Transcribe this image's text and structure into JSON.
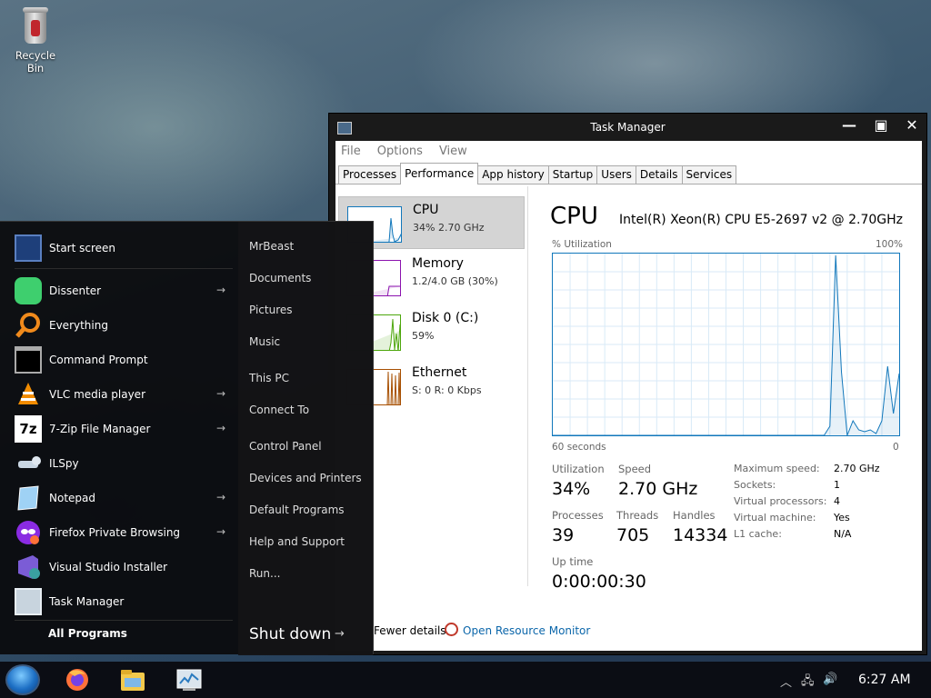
{
  "desktop": {
    "recycle_bin": "Recycle Bin"
  },
  "task_manager": {
    "title": "Task Manager",
    "window_buttons": {
      "minimize": "—",
      "maximize": "▣",
      "close": "✕"
    },
    "menu": [
      "File",
      "Options",
      "View"
    ],
    "tabs": [
      "Processes",
      "Performance",
      "App history",
      "Startup",
      "Users",
      "Details",
      "Services"
    ],
    "active_tab": "Performance",
    "sidebar": [
      {
        "name": "CPU",
        "value": "34% 2.70 GHz",
        "color": "#1177bb"
      },
      {
        "name": "Memory",
        "value": "1.2/4.0 GB (30%)",
        "color": "#8b12ae"
      },
      {
        "name": "Disk 0 (C:)",
        "value": "59%",
        "color": "#4da60c"
      },
      {
        "name": "Ethernet",
        "value": "S: 0 R: 0 Kbps",
        "color": "#a74f01"
      }
    ],
    "cpu": {
      "heading": "CPU",
      "model": "Intel(R) Xeon(R) CPU E5-2697 v2 @ 2.70GHz",
      "graph_label_left": "% Utilization",
      "graph_label_right": "100%",
      "graph_time_left": "60 seconds",
      "graph_time_right": "0",
      "utilization_history_pct": [
        0,
        0,
        0,
        0,
        0,
        0,
        0,
        0,
        0,
        0,
        0,
        0,
        0,
        0,
        0,
        0,
        0,
        0,
        0,
        0,
        0,
        0,
        0,
        0,
        0,
        0,
        0,
        0,
        0,
        0,
        0,
        0,
        0,
        0,
        0,
        0,
        0,
        0,
        0,
        0,
        0,
        0,
        0,
        0,
        0,
        0,
        0,
        0,
        5,
        99,
        35,
        0,
        8,
        3,
        2,
        3,
        1,
        8,
        38,
        12,
        34
      ],
      "stats": {
        "utilization_label": "Utilization",
        "utilization": "34%",
        "speed_label": "Speed",
        "speed": "2.70 GHz",
        "processes_label": "Processes",
        "processes": "39",
        "threads_label": "Threads",
        "threads": "705",
        "handles_label": "Handles",
        "handles": "14334",
        "uptime_label": "Up time",
        "uptime": "0:00:00:30"
      },
      "details": [
        {
          "key": "Maximum speed:",
          "value": "2.70 GHz"
        },
        {
          "key": "Sockets:",
          "value": "1"
        },
        {
          "key": "Virtual processors:",
          "value": "4"
        },
        {
          "key": "Virtual machine:",
          "value": "Yes"
        },
        {
          "key": "L1 cache:",
          "value": "N/A"
        }
      ]
    },
    "footer": {
      "fewer_details": "Fewer details",
      "open_resource_monitor": "Open Resource Monitor"
    }
  },
  "start_menu": {
    "items": [
      {
        "label": "Start screen",
        "arrow": false
      },
      {
        "label": "Dissenter",
        "arrow": true
      },
      {
        "label": "Everything",
        "arrow": false
      },
      {
        "label": "Command Prompt",
        "arrow": false
      },
      {
        "label": "VLC media player",
        "arrow": true
      },
      {
        "label": "7-Zip File Manager",
        "arrow": true
      },
      {
        "label": "ILSpy",
        "arrow": false
      },
      {
        "label": "Notepad",
        "arrow": true
      },
      {
        "label": "Firefox Private Browsing",
        "arrow": true
      },
      {
        "label": "Visual Studio Installer",
        "arrow": false
      },
      {
        "label": "Task Manager",
        "arrow": false
      }
    ],
    "all_programs": "All Programs",
    "right_items": [
      "MrBeast",
      "Documents",
      "Pictures",
      "Music",
      "This PC",
      "Connect To",
      "Control Panel",
      "Devices and Printers",
      "Default Programs",
      "Help and Support",
      "Run..."
    ],
    "shutdown": "Shut down",
    "submenu_arrow": "→"
  },
  "taskbar": {
    "clock": "6:27 AM",
    "tray_icons": [
      "chevron-up-icon",
      "network-icon",
      "volume-icon"
    ]
  }
}
